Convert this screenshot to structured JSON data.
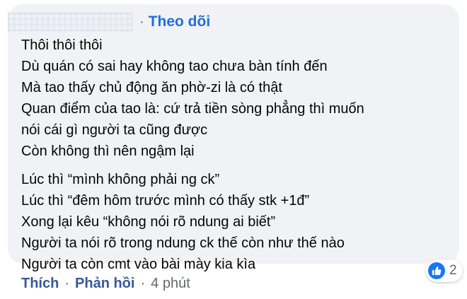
{
  "comment": {
    "follow_label": "Theo dõi",
    "separator": "·",
    "paragraph1": [
      "Thôi thôi thôi",
      "Dù quán có sai hay không tao chưa bàn tính đến",
      "Mà tao thấy chủ động ăn phờ-zi là có thật",
      "Quan điểm của tao là: cứ trả tiền sòng phẳng thì muốn",
      "nói cái gì người ta cũng được",
      "Còn không thì nên ngậm lại"
    ],
    "paragraph2": [
      "Lúc thì “mình không phải ng ck”",
      "Lúc thì “đêm hôm trước mình có thấy stk +1đ”",
      "Xong lại kêu “không nói rõ ndung ai biết”",
      "Người ta nói rõ trong ndung ck thế còn như thế nào",
      "Người ta còn cmt vào bài mày kia kìa"
    ]
  },
  "reactions": {
    "icon": "like-icon",
    "count": "2",
    "color": "#1877f2"
  },
  "actions": {
    "like_label": "Thích",
    "reply_label": "Phản hồi",
    "separator": "·",
    "time": "4 phút"
  }
}
